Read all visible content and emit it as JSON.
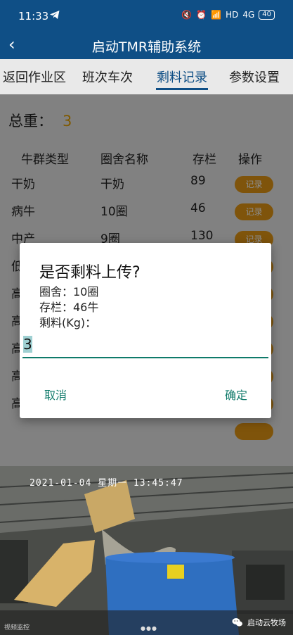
{
  "status_bar": {
    "time": "11:33",
    "right_icons": [
      "mute-vibrate-icon",
      "alarm-icon",
      "wifi-icon"
    ],
    "hd_label": "HD",
    "signal_label": "4G",
    "battery": "40"
  },
  "header": {
    "back_icon": "chevron-left-icon",
    "title": "启动TMR辅助系统"
  },
  "tabs": [
    {
      "label": "返回作业区"
    },
    {
      "label": "班次车次"
    },
    {
      "label": "剩料记录",
      "active": true
    },
    {
      "label": "参数设置"
    }
  ],
  "summary": {
    "total_label": "总重：",
    "total_value": "3"
  },
  "table": {
    "headers": [
      "牛群类型",
      "圈舍名称",
      "存栏",
      "操作"
    ],
    "rows": [
      {
        "type": "干奶",
        "pen": "干奶",
        "stock": "89",
        "action": "记录"
      },
      {
        "type": "病牛",
        "pen": "10圈",
        "stock": "46",
        "action": "记录"
      },
      {
        "type": "中产",
        "pen": "9圈",
        "stock": "130",
        "action": "记录"
      },
      {
        "type": "低",
        "pen": "",
        "stock": "",
        "action": ""
      },
      {
        "type": "高",
        "pen": "",
        "stock": "",
        "action": ""
      },
      {
        "type": "高",
        "pen": "",
        "stock": "",
        "action": ""
      },
      {
        "type": "高",
        "pen": "",
        "stock": "",
        "action": ""
      },
      {
        "type": "高",
        "pen": "",
        "stock": "",
        "action": ""
      },
      {
        "type": "高",
        "pen": "",
        "stock": "",
        "action": ""
      }
    ]
  },
  "dialog": {
    "title": "是否剩料上传?",
    "pen_line": "圈舍：10圈",
    "stock_line": "存栏：46牛",
    "feed_label": "剩料(Kg)：",
    "input_value": "3",
    "cancel_label": "取消",
    "confirm_label": "确定"
  },
  "video": {
    "timestamp": "2021-01-04 星期一 13:45:47",
    "watermark": "启动云牧场",
    "source_label": "视频监控",
    "colors": {
      "sky": "#5d5f5b",
      "mixer": "#2f6fc0",
      "loader": "#d8b36a"
    }
  },
  "colors": {
    "brand": "#0f4f86",
    "accent": "#e89a14",
    "dialog_accent": "#0f7a6a",
    "total_value": "#e8a200"
  }
}
